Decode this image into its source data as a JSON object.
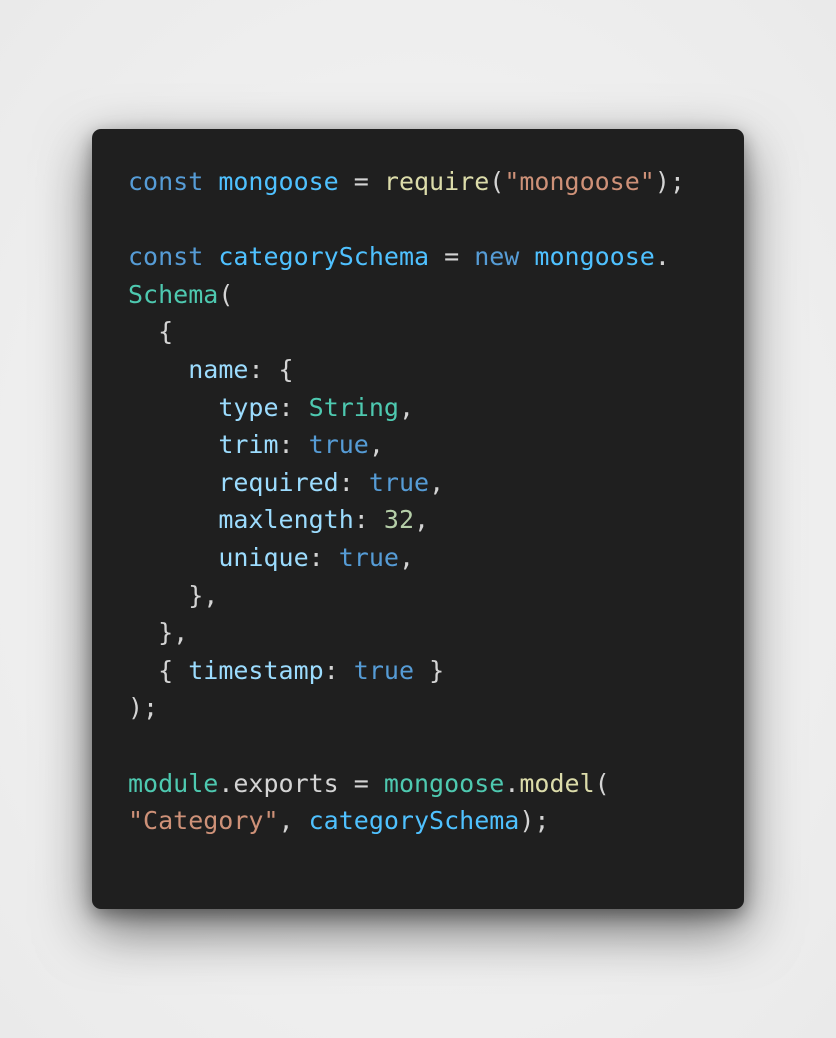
{
  "code": {
    "lines": [
      [
        {
          "t": "const",
          "k": "kw"
        },
        {
          "t": " ",
          "k": "plain"
        },
        {
          "t": "mongoose",
          "k": "var"
        },
        {
          "t": " = ",
          "k": "pun"
        },
        {
          "t": "require",
          "k": "fn"
        },
        {
          "t": "(",
          "k": "pun"
        },
        {
          "t": "\"mongoose\"",
          "k": "str"
        },
        {
          "t": ");",
          "k": "pun"
        }
      ],
      [],
      [
        {
          "t": "const",
          "k": "kw"
        },
        {
          "t": " ",
          "k": "plain"
        },
        {
          "t": "categorySchema",
          "k": "var"
        },
        {
          "t": " = ",
          "k": "pun"
        },
        {
          "t": "new",
          "k": "kw"
        },
        {
          "t": " ",
          "k": "plain"
        },
        {
          "t": "mongoose",
          "k": "var"
        },
        {
          "t": ".",
          "k": "pun"
        }
      ],
      [
        {
          "t": "Schema",
          "k": "cls"
        },
        {
          "t": "(",
          "k": "pun"
        }
      ],
      [
        {
          "t": "  {",
          "k": "pun"
        }
      ],
      [
        {
          "t": "    ",
          "k": "plain"
        },
        {
          "t": "name",
          "k": "prop"
        },
        {
          "t": ": {",
          "k": "pun"
        }
      ],
      [
        {
          "t": "      ",
          "k": "plain"
        },
        {
          "t": "type",
          "k": "prop"
        },
        {
          "t": ": ",
          "k": "pun"
        },
        {
          "t": "String",
          "k": "cls"
        },
        {
          "t": ",",
          "k": "pun"
        }
      ],
      [
        {
          "t": "      ",
          "k": "plain"
        },
        {
          "t": "trim",
          "k": "prop"
        },
        {
          "t": ": ",
          "k": "pun"
        },
        {
          "t": "true",
          "k": "kw"
        },
        {
          "t": ",",
          "k": "pun"
        }
      ],
      [
        {
          "t": "      ",
          "k": "plain"
        },
        {
          "t": "required",
          "k": "prop"
        },
        {
          "t": ": ",
          "k": "pun"
        },
        {
          "t": "true",
          "k": "kw"
        },
        {
          "t": ",",
          "k": "pun"
        }
      ],
      [
        {
          "t": "      ",
          "k": "plain"
        },
        {
          "t": "maxlength",
          "k": "prop"
        },
        {
          "t": ": ",
          "k": "pun"
        },
        {
          "t": "32",
          "k": "num"
        },
        {
          "t": ",",
          "k": "pun"
        }
      ],
      [
        {
          "t": "      ",
          "k": "plain"
        },
        {
          "t": "unique",
          "k": "prop"
        },
        {
          "t": ": ",
          "k": "pun"
        },
        {
          "t": "true",
          "k": "kw"
        },
        {
          "t": ",",
          "k": "pun"
        }
      ],
      [
        {
          "t": "    },",
          "k": "pun"
        }
      ],
      [
        {
          "t": "  },",
          "k": "pun"
        }
      ],
      [
        {
          "t": "  { ",
          "k": "pun"
        },
        {
          "t": "timestamp",
          "k": "prop"
        },
        {
          "t": ": ",
          "k": "pun"
        },
        {
          "t": "true",
          "k": "kw"
        },
        {
          "t": " }",
          "k": "pun"
        }
      ],
      [
        {
          "t": ");",
          "k": "pun"
        }
      ],
      [],
      [
        {
          "t": "module",
          "k": "cls"
        },
        {
          "t": ".",
          "k": "pun"
        },
        {
          "t": "exports",
          "k": "plain"
        },
        {
          "t": " = ",
          "k": "pun"
        },
        {
          "t": "mongoose",
          "k": "var2"
        },
        {
          "t": ".",
          "k": "pun"
        },
        {
          "t": "model",
          "k": "fn"
        },
        {
          "t": "(",
          "k": "pun"
        }
      ],
      [
        {
          "t": "\"Category\"",
          "k": "str"
        },
        {
          "t": ", ",
          "k": "pun"
        },
        {
          "t": "categorySchema",
          "k": "var"
        },
        {
          "t": ");",
          "k": "pun"
        }
      ]
    ]
  },
  "colors": {
    "background": "#efefef",
    "card": "#1f1f1f",
    "keyword": "#569cd6",
    "variable": "#4fc1ff",
    "function": "#dcdcaa",
    "string": "#ce9178",
    "class": "#4ec9b0",
    "property": "#9cdcfe",
    "number": "#b5cea8",
    "punctuation": "#d4d4d4"
  }
}
